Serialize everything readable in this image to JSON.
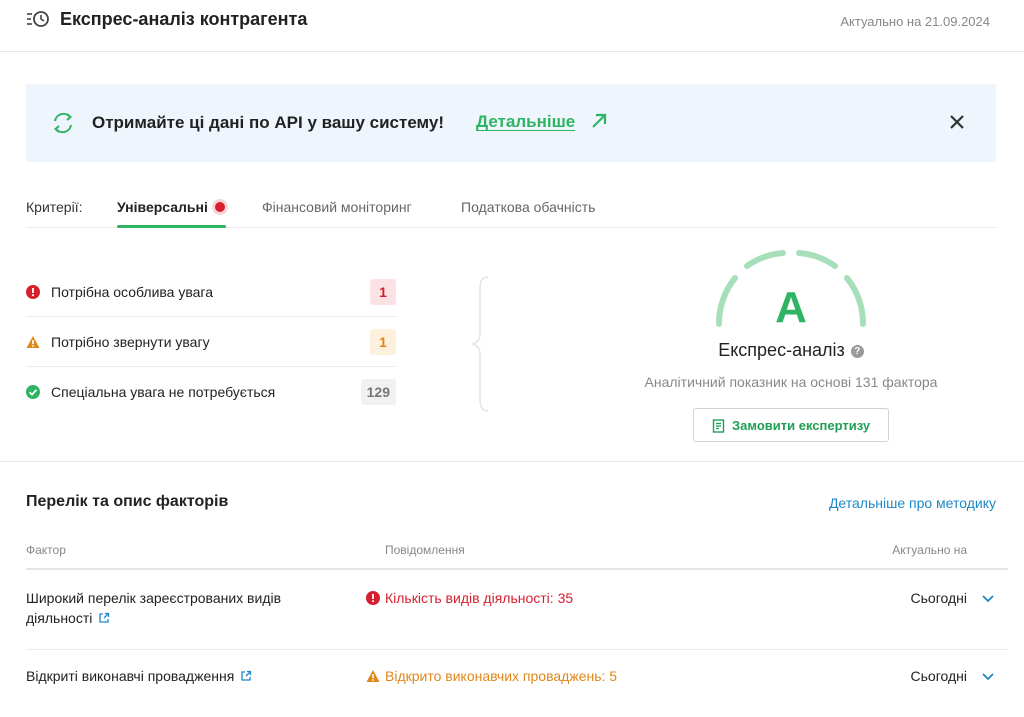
{
  "header": {
    "title": "Експрес-аналіз контрагента",
    "date": "Актуально на 21.09.2024"
  },
  "banner": {
    "text": "Отримайте ці дані по API у вашу систему!",
    "link": "Детальніше"
  },
  "tabs": {
    "label": "Критерії:",
    "items": [
      {
        "label": "Універсальні",
        "active": true
      },
      {
        "label": "Фінансовий моніторинг",
        "active": false
      },
      {
        "label": "Податкова обачність",
        "active": false
      }
    ]
  },
  "criteria": [
    {
      "label": "Потрібна особлива увага",
      "count": "1",
      "icon": "error-icon",
      "color": "#d6202f",
      "badge_bg": "#fbe3e5"
    },
    {
      "label": "Потрібно звернути увагу",
      "count": "1",
      "icon": "warning-icon",
      "color": "#e0871b",
      "badge_bg": "#fdf0dd"
    },
    {
      "label": "Спеціальна увага не потребується",
      "count": "129",
      "icon": "check-icon",
      "color": "#2fb463",
      "badge_bg": "#f1f1f1"
    }
  ],
  "analysis": {
    "grade": "A",
    "title": "Експрес-аналіз",
    "help": "?",
    "subtitle": "Аналітичний показник на основі 131 фактора",
    "button": "Замовити експертизу"
  },
  "factors": {
    "title": "Перелік та опис факторів",
    "method_link": "Детальніше про методику",
    "columns": [
      "Фактор",
      "Повідомлення",
      "Актуально на"
    ],
    "rows": [
      {
        "line1": "Широкий перелік зареєстрованих видів",
        "line2": "діяльності",
        "message": "Кількість видів діяльності: 35",
        "status": "Сьогодні",
        "level": "error"
      },
      {
        "line1": "Відкриті виконавчі провадження",
        "line2": "",
        "message": "Відкрито виконавчих проваджень: 5",
        "status": "Сьогодні",
        "level": "warning"
      }
    ]
  },
  "colors": {
    "accent": "#2fb463",
    "error": "#d6202f",
    "warning": "#e0871b",
    "link": "#1e88c8",
    "banner_bg": "#eef5fc"
  }
}
